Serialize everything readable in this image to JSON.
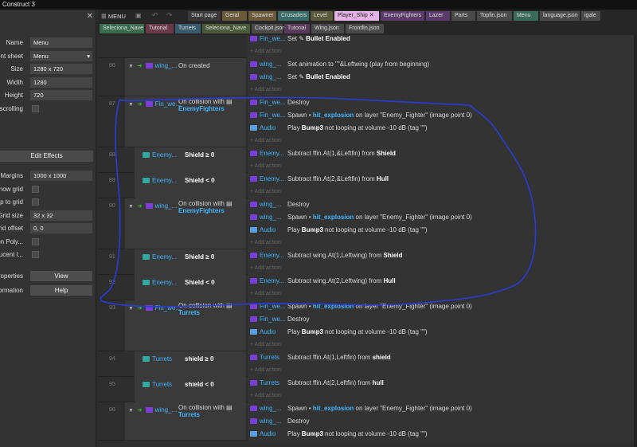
{
  "app": {
    "title": "Construct 3"
  },
  "left_panel": {
    "properties": [
      {
        "label": "Name",
        "value": "Menu",
        "kind": "text"
      },
      {
        "label": "ent sheet",
        "value": "Menu",
        "kind": "select"
      },
      {
        "label": "Size",
        "value": "1280 x 720",
        "kind": "text"
      },
      {
        "label": "Width",
        "value": "1280",
        "kind": "text"
      },
      {
        "label": "Height",
        "value": "720",
        "kind": "text"
      },
      {
        "label": "scrolling",
        "value": "",
        "kind": "check"
      }
    ],
    "edit_effects": "Edit Effects",
    "properties2": [
      {
        "label": "Margins",
        "value": "1000 x 1000",
        "kind": "text"
      },
      {
        "label": "how grid",
        "value": "",
        "kind": "check"
      },
      {
        "label": "ap to grid",
        "value": "",
        "kind": "check"
      },
      {
        "label": "Grid size",
        "value": "32 x 32",
        "kind": "text"
      },
      {
        "label": "rid offset",
        "value": "0, 0",
        "kind": "text"
      },
      {
        "label": "on Poly...",
        "value": "",
        "kind": "check"
      },
      {
        "label": "ucent l...",
        "value": "",
        "kind": "check"
      },
      {
        "label": "roperties",
        "value": "View",
        "kind": "button"
      },
      {
        "label": "ormation",
        "value": "Help",
        "kind": "button"
      }
    ]
  },
  "toolbar": {
    "menu": "MENU"
  },
  "tabs_row1": [
    {
      "label": "Start page",
      "color": "#3a3a3a"
    },
    {
      "label": "Geral",
      "color": "#6b5a3a"
    },
    {
      "label": "Spawner",
      "color": "#6b5a3a"
    },
    {
      "label": "Crusaders",
      "color": "#3a6b6b"
    },
    {
      "label": "Level",
      "color": "#5a5a3a"
    },
    {
      "label": "Player_Ship",
      "color": "#e6b3e6",
      "active": true
    },
    {
      "label": "EnemyFighters",
      "color": "#5a3a6b"
    },
    {
      "label": "Lazer",
      "color": "#5a3a6b"
    },
    {
      "label": "Parts",
      "color": "#4a4a4a"
    },
    {
      "label": "Topfin.json",
      "color": "#4a4a4a"
    },
    {
      "label": "Menu",
      "color": "#3a6b5a"
    },
    {
      "label": "language.json",
      "color": "#4a4a4a"
    },
    {
      "label": "igale",
      "color": "#4a4a4a"
    }
  ],
  "tabs_row2": [
    {
      "label": "Seleciona_Nave",
      "color": "#3a6b4a"
    },
    {
      "label": "Tutorial",
      "color": "#6b3a4a"
    },
    {
      "label": "Turrets",
      "color": "#3a5a6b"
    },
    {
      "label": "Seleciona_Nave",
      "color": "#4a5a3a"
    },
    {
      "label": "Cockpit.json",
      "color": "#4a4a4a"
    },
    {
      "label": "Tutorial",
      "color": "#5a3a5a"
    },
    {
      "label": "Wing.json",
      "color": "#4a4a4a"
    },
    {
      "label": "Frontfin.json",
      "color": "#4a4a4a"
    }
  ],
  "events": {
    "top_block": {
      "actions": [
        {
          "obj": "Fin_we...",
          "icon": "purple",
          "text": "Set",
          "bold": "Bullet Enabled"
        }
      ],
      "add_action": "Add action"
    },
    "e86": {
      "num": "86",
      "obj": "wing_...",
      "cond": "On created",
      "actions": [
        {
          "obj": "wing_...",
          "icon": "purple",
          "text": "Set animation to \"\"&Leftwing (play from beginning)"
        },
        {
          "obj": "wing_...",
          "icon": "purple",
          "text": "Set",
          "bold": "Bullet Enabled"
        }
      ],
      "add_action": "Add action"
    },
    "e87": {
      "num": "87",
      "obj": "Fin_we...",
      "cond": "On collision with",
      "target": "EnemyFighters",
      "actions": [
        {
          "obj": "Fin_we...",
          "icon": "purple",
          "text": "Destroy"
        },
        {
          "obj": "Fin_we...",
          "icon": "purple",
          "text": "Spawn",
          "bold": "hit_explosion",
          "rest": "on layer \"Enemy_Fighter\" (image point 0)"
        },
        {
          "obj": "Audio",
          "icon": "audio",
          "text": "Play",
          "bold": "Bump3",
          "rest": "not looping at volume -10 dB (tag \"\")"
        }
      ],
      "add_action": "Add action"
    },
    "e88": {
      "num": "88",
      "obj": "Enemy...",
      "cond": "Shield ≥ 0",
      "actions": [
        {
          "obj": "Enemy...",
          "text": "Subtract ffin.At(1,&Leftfin) from",
          "bold": "Shield"
        }
      ],
      "add_action": "Add action"
    },
    "e89": {
      "num": "89",
      "obj": "Enemy...",
      "cond": "Shield < 0",
      "actions": [
        {
          "obj": "Enemy...",
          "text": "Subtract ffin.At(2,&Leftfin) from",
          "bold": "Hull"
        }
      ],
      "add_action": "Add action"
    },
    "e90": {
      "num": "90",
      "obj": "wing_...",
      "cond": "On collision with",
      "target": "EnemyFighters",
      "actions": [
        {
          "obj": "wing_...",
          "icon": "purple",
          "text": "Destroy"
        },
        {
          "obj": "wing_...",
          "icon": "purple",
          "text": "Spawn",
          "bold": "hit_explosion",
          "rest": "on layer \"Enemy_Fighter\" (image point 0)"
        },
        {
          "obj": "Audio",
          "icon": "audio",
          "text": "Play",
          "bold": "Bump3",
          "rest": "not looping at volume -10 dB (tag \"\")"
        }
      ],
      "add_action": "Add action"
    },
    "e91": {
      "num": "91",
      "obj": "Enemy...",
      "cond": "Shield ≥ 0",
      "actions": [
        {
          "obj": "Enemy...",
          "text": "Subtract wing.At(1,Leftwing) from",
          "bold": "Shield"
        }
      ],
      "add_action": "Add action"
    },
    "e92": {
      "num": "92",
      "obj": "Enemy...",
      "cond": "Shield < 0",
      "actions": [
        {
          "obj": "Enemy...",
          "text": "Subtract wing.At(2,Leftwing) from",
          "bold": "Hull"
        }
      ],
      "add_action": "Add action"
    },
    "e93": {
      "num": "93",
      "obj": "Fin_we...",
      "cond": "On collision with",
      "target": "Turrets",
      "actions": [
        {
          "obj": "Fin_we...",
          "icon": "purple",
          "text": "Spawn",
          "bold": "hit_explosion",
          "rest": "on layer \"Enemy_Fighter\" (image point 0)"
        },
        {
          "obj": "Fin_we...",
          "icon": "purple",
          "text": "Destroy"
        },
        {
          "obj": "Audio",
          "icon": "audio",
          "text": "Play",
          "bold": "Bump3",
          "rest": "not looping at volume -10 dB (tag \"\")"
        }
      ],
      "add_action": "Add action"
    },
    "e94": {
      "num": "94",
      "obj": "Turrets",
      "cond": "shield ≥ 0",
      "actions": [
        {
          "obj": "Turrets",
          "text": "Subtract ffin.At(1,Leftfin) from",
          "bold": "shield"
        }
      ],
      "add_action": "Add action"
    },
    "e95": {
      "num": "95",
      "obj": "Turrets",
      "cond": "shield < 0",
      "actions": [
        {
          "obj": "Turrets",
          "text": "Subtract ffin.At(2,Leftfin) from",
          "bold": "hull"
        }
      ],
      "add_action": "Add action"
    },
    "e96": {
      "num": "96",
      "obj": "wing_...",
      "cond": "On collision with",
      "target": "Turrets",
      "actions": [
        {
          "obj": "wing_...",
          "icon": "purple",
          "text": "Spawn",
          "bold": "hit_explosion",
          "rest": "on layer \"Enemy_Fighter\" (image point 0)"
        },
        {
          "obj": "wing_...",
          "icon": "purple",
          "text": "Destroy"
        },
        {
          "obj": "Audio",
          "icon": "audio",
          "text": "Play",
          "bold": "Bump3",
          "rest": "not looping at volume -10 dB (tag \"\")"
        }
      ]
    }
  },
  "colors": {
    "annotation": "#2a3bd6",
    "object_text": "#3fb5ff",
    "trigger_arrow": "#2fbf3a"
  }
}
